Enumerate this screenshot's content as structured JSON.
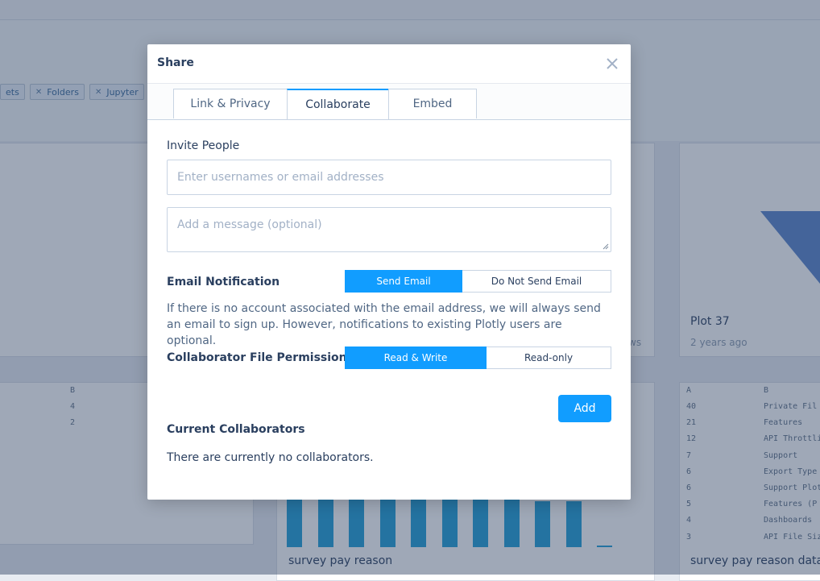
{
  "background": {
    "chips": [
      {
        "label": "ets",
        "icon": "close-icon"
      },
      {
        "label": "Folders",
        "icon": "close-icon"
      },
      {
        "label": "Jupyter",
        "icon": "close-icon"
      }
    ],
    "cards": {
      "plot37_title": "Plot 37",
      "plot37_time": "2 years ago",
      "views_partial": "ws",
      "survey_title": "survey pay reason",
      "survey_data_title": "survey pay reason data"
    },
    "left_sheet": {
      "col_header": "B",
      "rows": [
        "4",
        "2"
      ]
    },
    "right_sheet": {
      "col_a": "A",
      "col_b": "B",
      "rows": [
        {
          "a": "40",
          "b": "Private Fil"
        },
        {
          "a": "21",
          "b": "Features"
        },
        {
          "a": "12",
          "b": "API Throttli"
        },
        {
          "a": "7",
          "b": "Support"
        },
        {
          "a": "6",
          "b": "Export Type"
        },
        {
          "a": "6",
          "b": "Support Plot"
        },
        {
          "a": "5",
          "b": "Features (P"
        },
        {
          "a": "4",
          "b": "Dashboards"
        },
        {
          "a": "3",
          "b": "API File Siz"
        }
      ]
    },
    "bar_values": [
      95,
      95,
      95,
      95,
      95,
      95,
      95,
      95,
      57,
      57,
      2
    ]
  },
  "modal": {
    "title": "Share",
    "close_icon": "close-icon",
    "tabs": [
      {
        "label": "Link & Privacy",
        "active": false
      },
      {
        "label": "Collaborate",
        "active": true
      },
      {
        "label": "Embed",
        "active": false
      }
    ],
    "invite": {
      "label": "Invite People",
      "input_placeholder": "Enter usernames or email addresses",
      "message_placeholder": "Add a message (optional)"
    },
    "email_notification": {
      "label": "Email Notification",
      "options": [
        "Send Email",
        "Do Not Send Email"
      ],
      "selected": "Send Email",
      "helper": "If there is no account associated with the email address, we will always send an email to sign up. However, notifications to existing Plotly users are optional."
    },
    "permissions": {
      "label": "Collaborator File Permissions",
      "options": [
        "Read & Write",
        "Read-only"
      ],
      "selected": "Read & Write"
    },
    "add_label": "Add",
    "current": {
      "label": "Current Collaborators",
      "empty_text": "There are currently no collaborators."
    },
    "accent_color": "#119dff"
  }
}
